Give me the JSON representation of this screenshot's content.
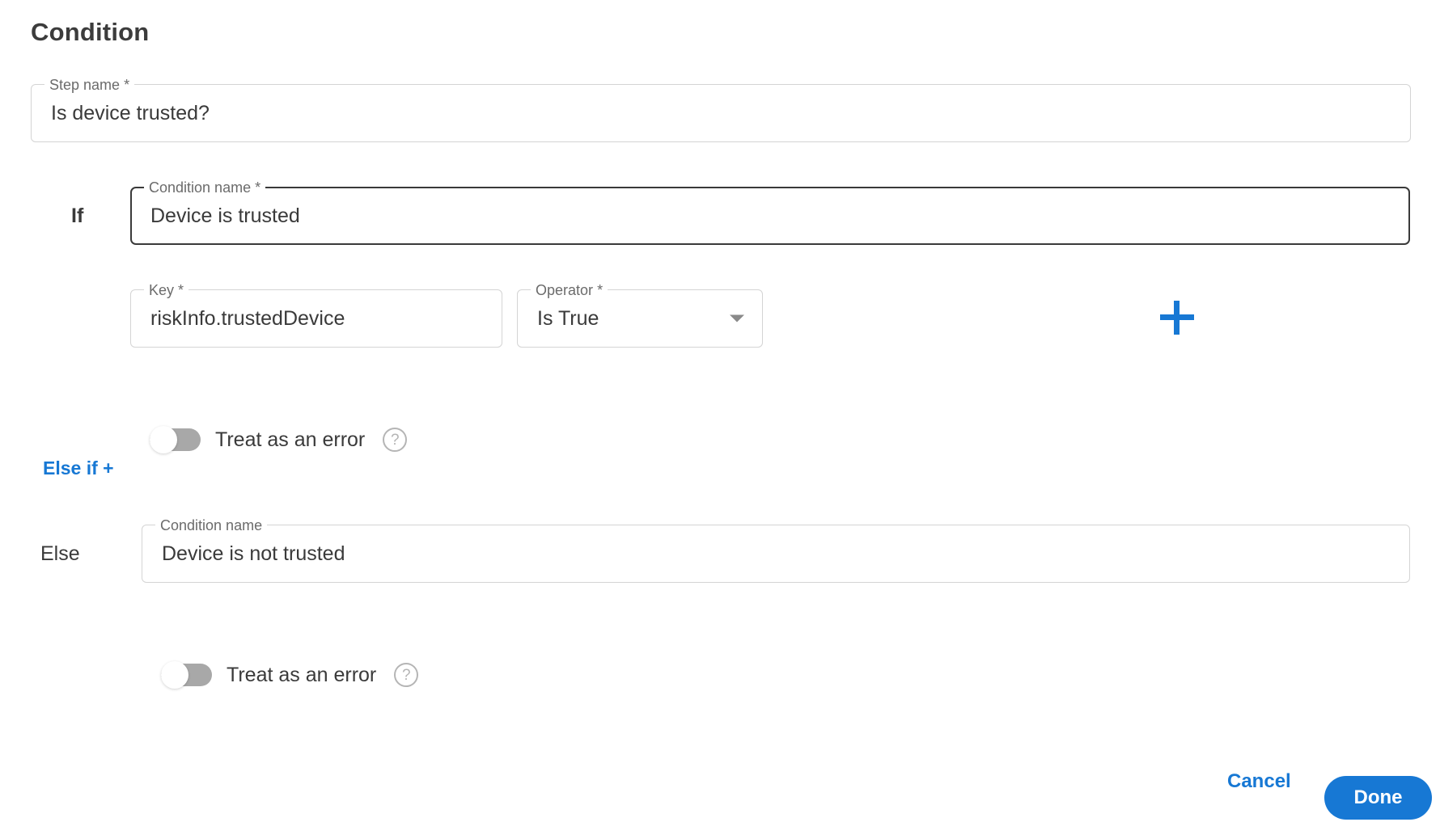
{
  "page": {
    "title": "Condition"
  },
  "step_name": {
    "legend": "Step name",
    "required_mark": "*",
    "value": "Is device trusted?"
  },
  "if_branch": {
    "branch_label": "If",
    "condition_name": {
      "legend": "Condition name",
      "required_mark": "*",
      "value": "Device is trusted"
    },
    "key": {
      "legend": "Key",
      "required_mark": "*",
      "value": "riskInfo.trustedDevice"
    },
    "operator": {
      "legend": "Operator",
      "required_mark": "*",
      "value": "Is True"
    },
    "add_button_icon": "plus-icon",
    "treat_as_error": {
      "label": "Treat as an error",
      "state": "off",
      "help_icon": "question-mark-icon"
    }
  },
  "else_if_link": {
    "label": "Else if +"
  },
  "else_branch": {
    "branch_label": "Else",
    "condition_name": {
      "legend": "Condition name",
      "required_mark": "",
      "value": "Device is not trusted"
    },
    "treat_as_error": {
      "label": "Treat as an error",
      "state": "off",
      "help_icon": "question-mark-icon"
    }
  },
  "footer": {
    "cancel_label": "Cancel",
    "done_label": "Done"
  },
  "colors": {
    "accent": "#1778d4",
    "text": "#3a3a3a",
    "muted": "#6b6b6b",
    "border": "#d4d4d4",
    "focus_border": "#3a3a3a",
    "toggle_track": "#a8a8a8"
  }
}
